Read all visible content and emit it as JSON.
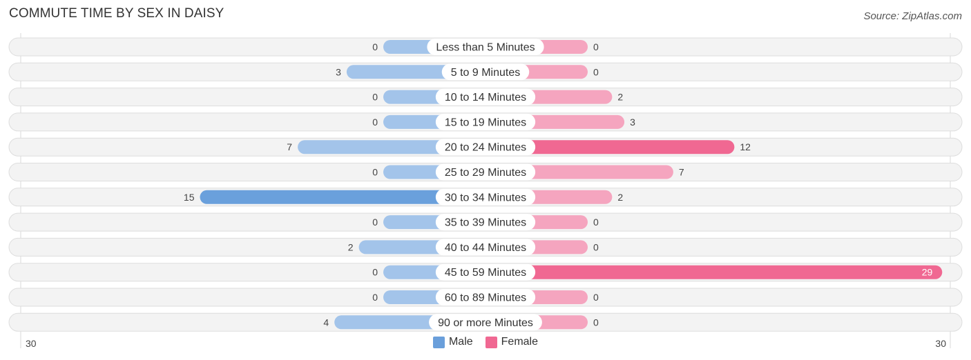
{
  "title": "COMMUTE TIME BY SEX IN DAISY",
  "source": "Source: ZipAtlas.com",
  "colors": {
    "male": "#6aa0dc",
    "male_light": "#a3c4ea",
    "female": "#f06892",
    "female_light": "#f5a5bf",
    "track": "#f3f3f3",
    "track_border": "#dddddd"
  },
  "legend": [
    {
      "label": "Male",
      "color": "#6a9fdb"
    },
    {
      "label": "Female",
      "color": "#f06892"
    }
  ],
  "chart_data": {
    "type": "bar",
    "orientation": "horizontal-diverging",
    "title": "COMMUTE TIME BY SEX IN DAISY",
    "categories": [
      "Less than 5 Minutes",
      "5 to 9 Minutes",
      "10 to 14 Minutes",
      "15 to 19 Minutes",
      "20 to 24 Minutes",
      "25 to 29 Minutes",
      "30 to 34 Minutes",
      "35 to 39 Minutes",
      "40 to 44 Minutes",
      "45 to 59 Minutes",
      "60 to 89 Minutes",
      "90 or more Minutes"
    ],
    "series": [
      {
        "name": "Male",
        "values": [
          0,
          3,
          0,
          0,
          7,
          0,
          15,
          0,
          2,
          0,
          0,
          4
        ]
      },
      {
        "name": "Female",
        "values": [
          0,
          0,
          2,
          3,
          12,
          7,
          2,
          0,
          0,
          29,
          0,
          0
        ]
      }
    ],
    "axis": {
      "left_label": "30",
      "right_label": "30",
      "max": 30
    },
    "legend_position": "bottom-center"
  }
}
